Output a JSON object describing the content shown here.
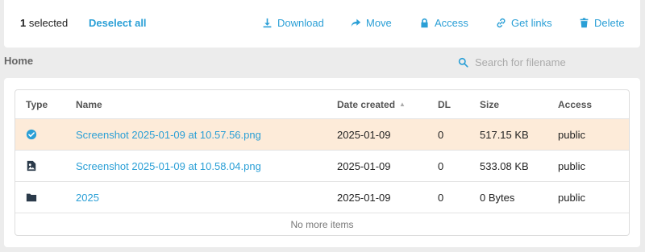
{
  "toolbar": {
    "selected_count": "1",
    "selected_label": " selected",
    "deselect_label": "Deselect all",
    "actions": [
      {
        "label": "Download",
        "icon": "download-icon"
      },
      {
        "label": "Move",
        "icon": "move-icon"
      },
      {
        "label": "Access",
        "icon": "lock-icon"
      },
      {
        "label": "Get links",
        "icon": "link-icon"
      },
      {
        "label": "Delete",
        "icon": "trash-icon"
      }
    ]
  },
  "breadcrumb": "Home",
  "search": {
    "placeholder": "Search for filename",
    "value": ""
  },
  "table": {
    "headers": {
      "type": "Type",
      "name": "Name",
      "date": "Date created",
      "dl": "DL",
      "size": "Size",
      "access": "Access"
    },
    "rows": [
      {
        "type_icon": "check-circle-icon",
        "name": "Screenshot 2025-01-09 at 10.57.56.png",
        "date": "2025-01-09",
        "dl": "0",
        "size": "517.15 KB",
        "access": "public",
        "selected": true
      },
      {
        "type_icon": "image-icon",
        "name": "Screenshot 2025-01-09 at 10.58.04.png",
        "date": "2025-01-09",
        "dl": "0",
        "size": "533.08 KB",
        "access": "public",
        "selected": false
      },
      {
        "type_icon": "folder-icon",
        "name": "2025",
        "date": "2025-01-09",
        "dl": "0",
        "size": "0 Bytes",
        "access": "public",
        "selected": false
      }
    ],
    "footer": "No more items"
  },
  "colors": {
    "accent": "#2a9fd6",
    "selected_row": "#fdebd9",
    "background": "#ececec"
  }
}
